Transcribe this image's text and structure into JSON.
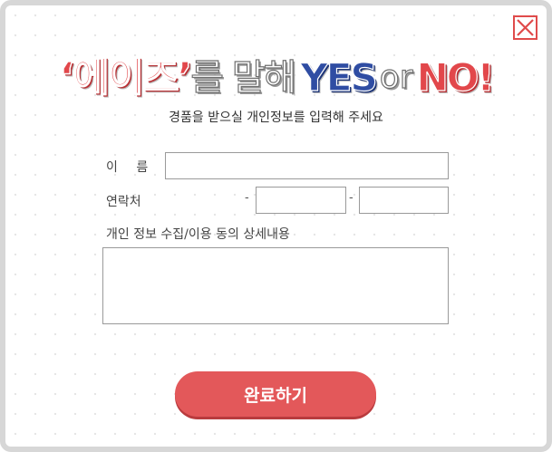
{
  "dialog": {
    "close_icon": "close-x-icon",
    "accent_color": "#e2474b",
    "blue_color": "#2f4da3"
  },
  "title": {
    "brand": "‘에이즈’",
    "middle": "를 말해",
    "yes": "YES",
    "or": "or",
    "no": "NO!"
  },
  "subtitle": "경품을 받으실 개인정보를 입력해 주세요",
  "form": {
    "name_label": "이 름",
    "name_value": "",
    "phone_label": "연락처",
    "phone_sep1": "-",
    "phone_sep2": "-",
    "phone_part1": "",
    "phone_part2": "",
    "phone_part3": "",
    "privacy_label": "개인 정보 수집/이용 동의 상세내용",
    "privacy_text": ""
  },
  "submit_label": "완료하기"
}
